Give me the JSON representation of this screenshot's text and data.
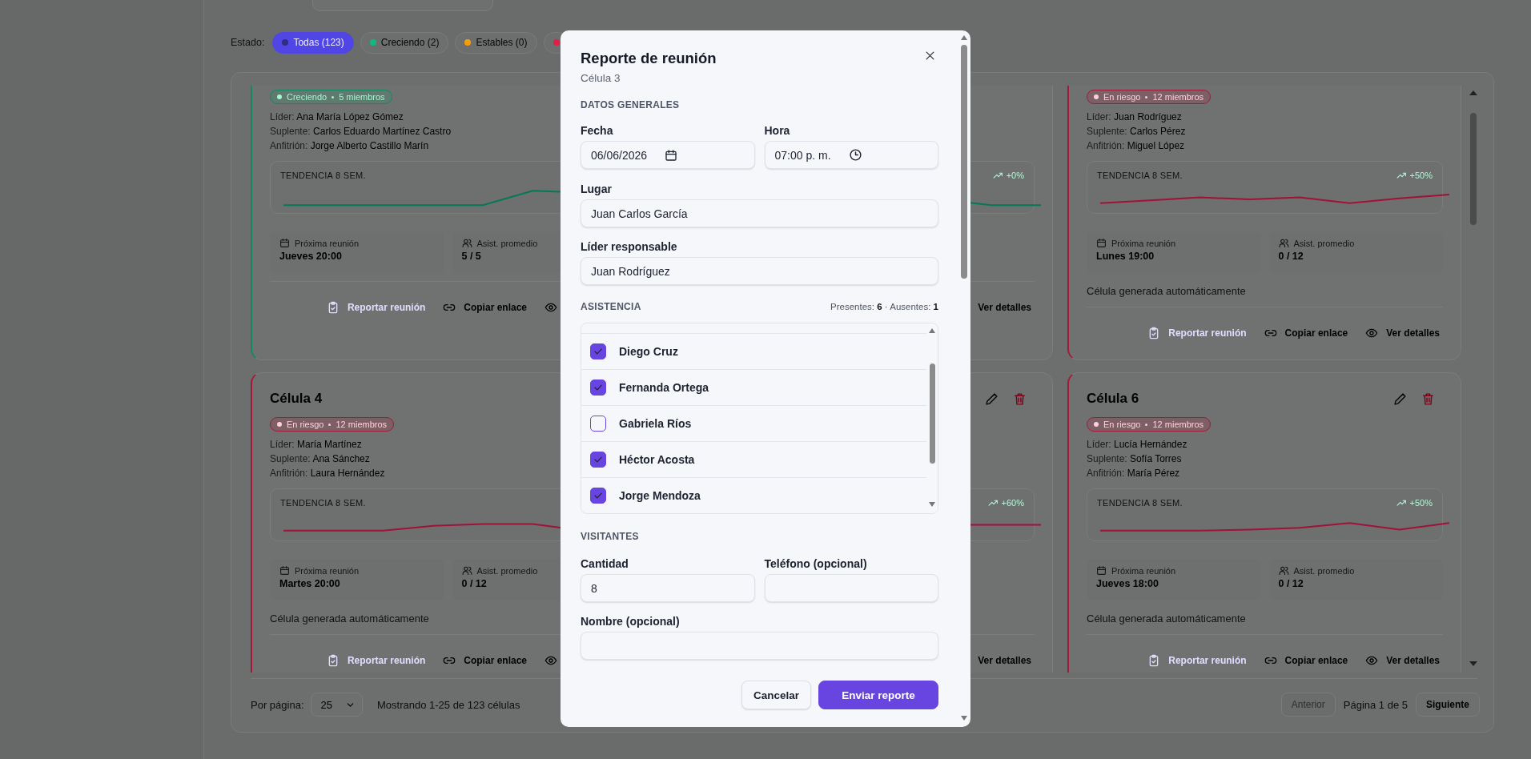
{
  "filter": {
    "label": "Estado:",
    "chips": [
      {
        "label": "Todas (123)",
        "selected": true,
        "color": "#312e81"
      },
      {
        "label": "Creciendo (2)",
        "selected": false,
        "color": "#10b981"
      },
      {
        "label": "Estables (0)",
        "selected": false,
        "color": "#f59e0b"
      },
      {
        "color": "#e11d48"
      }
    ]
  },
  "cards": [
    {
      "status": {
        "kind": "growing",
        "label": "Creciendo"
      },
      "members": "5 miembros",
      "people": [
        {
          "label": "Líder:",
          "value": "Ana María López Gómez"
        },
        {
          "label": "Suplente:",
          "value": "Carlos Eduardo Martínez Castro"
        },
        {
          "label": "Anfitrión:",
          "value": "Jorge Alberto Castillo Marín"
        }
      ],
      "trend": {
        "label": "TENDENCIA 8 SEM."
      },
      "stats": [
        {
          "kind": "calendar",
          "label": "Próxima reunión",
          "value": "Jueves 20:00"
        },
        {
          "kind": "people",
          "label": "Asist. promedio",
          "value": "5 / 5"
        }
      ],
      "actions": [
        {
          "kind": "report",
          "label": "Reportar reunión"
        },
        {
          "kind": "link",
          "label": "Copiar enlace"
        },
        {
          "kind": "view"
        }
      ]
    },
    {
      "status": {
        "kind": "growing"
      },
      "trend": {
        "change": "+0%"
      },
      "actions": [
        {
          "kind": "view",
          "label": "Ver detalles"
        }
      ]
    },
    {
      "status": {
        "kind": "risk",
        "label": "En riesgo"
      },
      "members": "12 miembros",
      "people": [
        {
          "label": "Líder:",
          "value": "Juan Rodríguez"
        },
        {
          "label": "Suplente:",
          "value": "Carlos Pérez"
        },
        {
          "label": "Anfitrión:",
          "value": "Miguel López"
        }
      ],
      "trend": {
        "label": "TENDENCIA 8 SEM.",
        "change": "+50%"
      },
      "stats": [
        {
          "kind": "calendar",
          "label": "Próxima reunión",
          "value": "Lunes 19:00"
        },
        {
          "kind": "people",
          "label": "Asist. promedio",
          "value": "0 / 12"
        }
      ],
      "description": "Célula generada automáticamente",
      "actions": [
        {
          "kind": "report",
          "label": "Reportar reunión"
        },
        {
          "kind": "link",
          "label": "Copiar enlace"
        },
        {
          "kind": "view",
          "label": "Ver detalles"
        }
      ]
    },
    {
      "title": "Célula 4",
      "status": {
        "kind": "risk",
        "label": "En riesgo"
      },
      "members": "12 miembros",
      "people": [
        {
          "label": "Líder:",
          "value": "María Martínez"
        },
        {
          "label": "Suplente:",
          "value": "Ana Sánchez"
        },
        {
          "label": "Anfitrión:",
          "value": "Laura Hernández"
        }
      ],
      "trend": {
        "label": "TENDENCIA 8 SEM."
      },
      "stats": [
        {
          "kind": "calendar",
          "label": "Próxima reunión",
          "value": "Martes 20:00"
        },
        {
          "kind": "people",
          "label": "Asist. promedio",
          "value": "0 / 12"
        }
      ],
      "description": "Célula generada automáticamente",
      "actions": [
        {
          "kind": "report",
          "label": "Reportar reunión"
        },
        {
          "kind": "link",
          "label": "Copiar enlace"
        },
        {
          "kind": "view"
        }
      ]
    },
    {
      "status": {
        "kind": "risk"
      },
      "tools": [
        {
          "kind": "edit"
        },
        {
          "kind": "delete"
        }
      ],
      "trend": {
        "change": "+60%"
      },
      "actions": [
        {
          "kind": "view",
          "label": "Ver detalles"
        }
      ]
    },
    {
      "title": "Célula 6",
      "tools": [
        {
          "kind": "edit"
        },
        {
          "kind": "delete"
        }
      ],
      "status": {
        "kind": "risk",
        "label": "En riesgo"
      },
      "members": "12 miembros",
      "people": [
        {
          "label": "Líder:",
          "value": "Lucía Hernández"
        },
        {
          "label": "Suplente:",
          "value": "Sofía Torres"
        },
        {
          "label": "Anfitrión:",
          "value": "María Pérez"
        }
      ],
      "trend": {
        "label": "TENDENCIA 8 SEM.",
        "change": "+50%"
      },
      "stats": [
        {
          "kind": "calendar",
          "label": "Próxima reunión",
          "value": "Jueves 18:00"
        },
        {
          "kind": "people",
          "label": "Asist. promedio",
          "value": "0 / 12"
        }
      ],
      "description": "Célula generada automáticamente",
      "actions": [
        {
          "kind": "report",
          "label": "Reportar reunión"
        },
        {
          "kind": "link",
          "label": "Copiar enlace"
        },
        {
          "kind": "view",
          "label": "Ver detalles"
        }
      ]
    }
  ],
  "pagination": {
    "per_page_label": "Por página:",
    "per_page": "25",
    "summary": "Mostrando 1-25 de 123 células",
    "prev": {
      "label": "Anterior",
      "disabled": true
    },
    "page": "Página 1 de 5",
    "next": {
      "label": "Siguiente",
      "disabled": false
    }
  },
  "modal": {
    "title": "Reporte de reunión",
    "subtitle": "Célula 3",
    "general": {
      "heading": "DATOS GENERALES",
      "date": {
        "label": "Fecha",
        "value": "06/06/2026"
      },
      "time": {
        "label": "Hora",
        "value": "07:00 p. m."
      },
      "place": {
        "label": "Lugar",
        "value": "Juan Carlos García"
      },
      "leader": {
        "label": "Líder responsable",
        "value": "Juan Rodríguez"
      }
    },
    "attendance": {
      "heading": "ASISTENCIA",
      "summary": "Presentes: **6** · Ausentes: **1**",
      "members": [
        {
          "name": "Diego Cruz",
          "checked": true
        },
        {
          "name": "Fernanda Ortega",
          "checked": true
        },
        {
          "name": "Gabriela Ríos",
          "checked": false
        },
        {
          "name": "Héctor Acosta",
          "checked": true
        },
        {
          "name": "Jorge Mendoza",
          "checked": true
        }
      ]
    },
    "visitors": {
      "heading": "VISITANTES",
      "count": {
        "label": "Cantidad",
        "value": "8"
      },
      "phone": {
        "label": "Teléfono (opcional)"
      },
      "name": {
        "label": "Nombre (opcional)"
      }
    },
    "buttons": [
      {
        "kind": "secondary",
        "label": "Cancelar"
      },
      {
        "kind": "primary",
        "label": "Enviar reporte"
      }
    ]
  }
}
